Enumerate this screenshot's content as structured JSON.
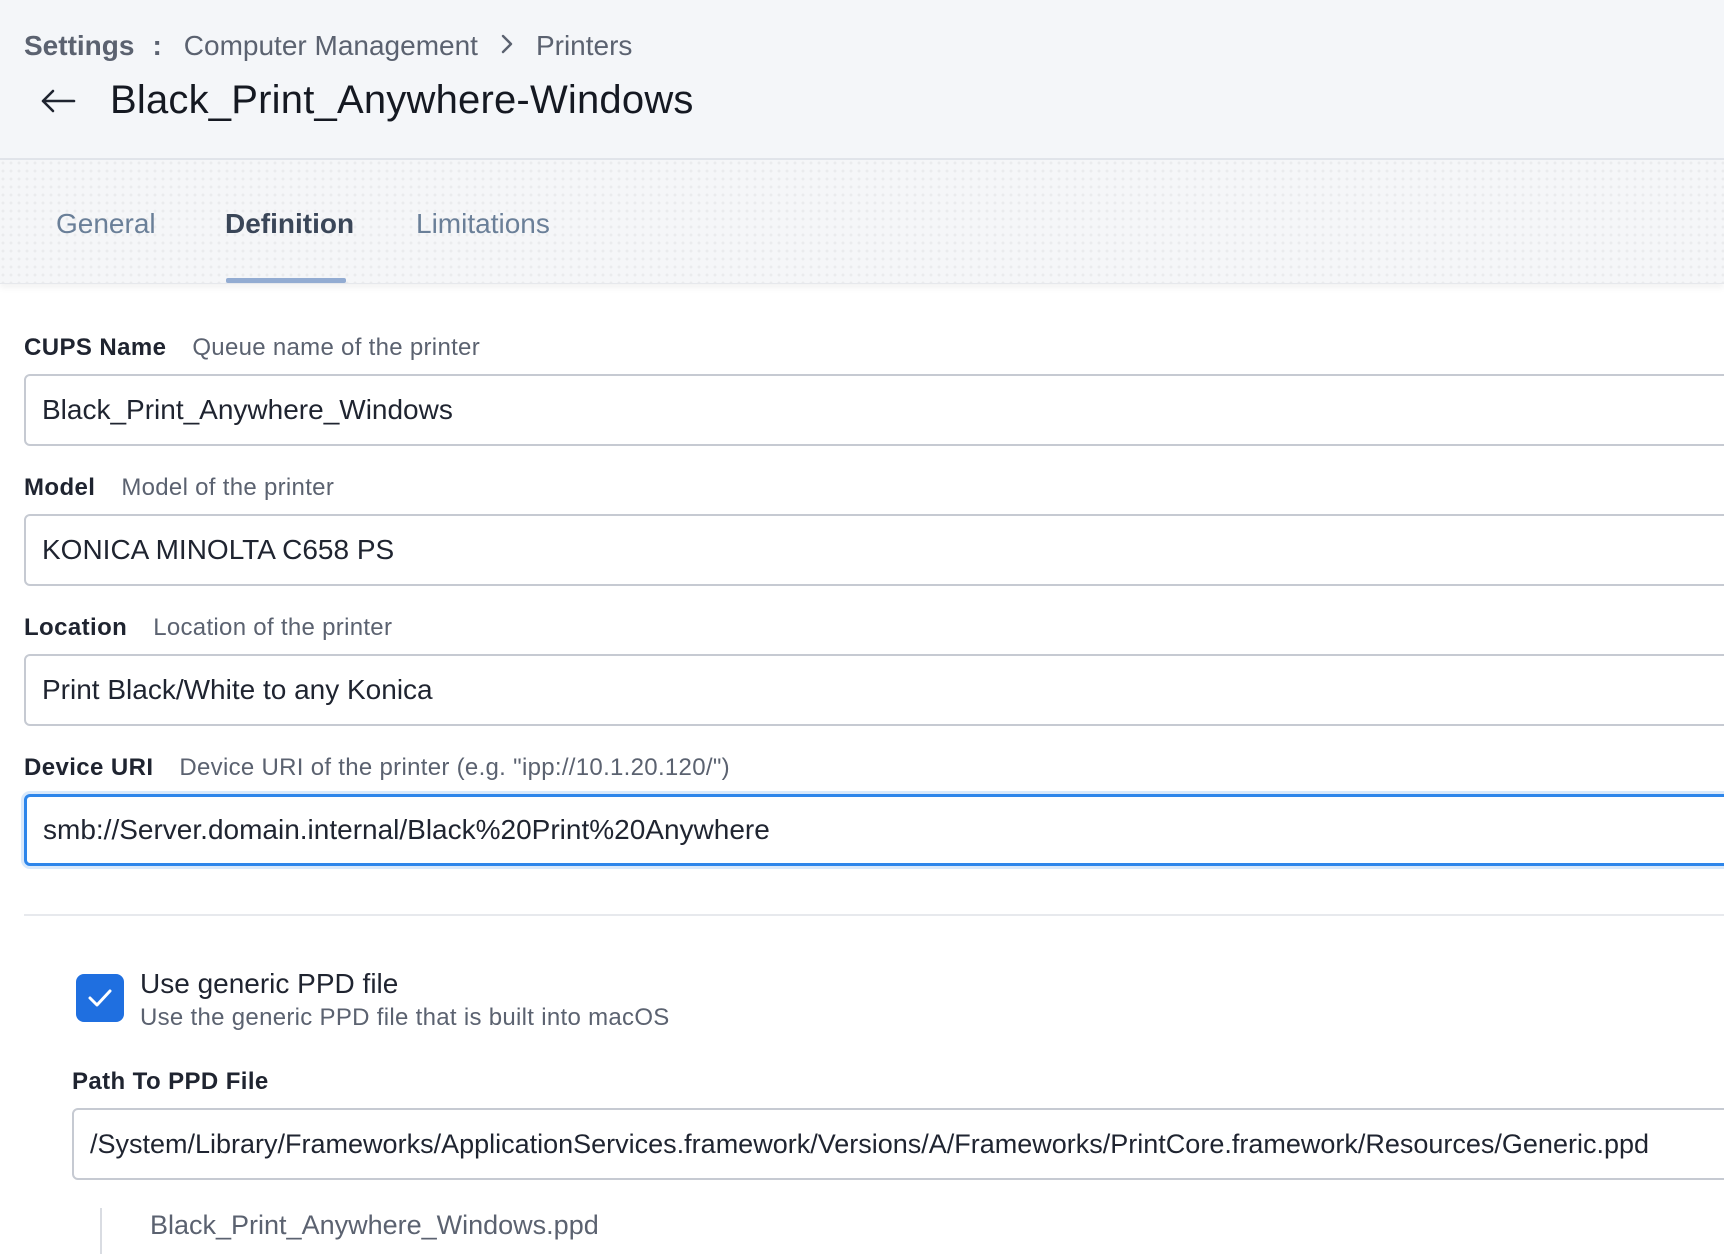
{
  "breadcrumb": {
    "root": "Settings",
    "separator": ":",
    "items": [
      "Computer Management",
      "Printers"
    ]
  },
  "page": {
    "title": "Black_Print_Anywhere-Windows"
  },
  "tabs": [
    {
      "label": "General",
      "active": false
    },
    {
      "label": "Definition",
      "active": true
    },
    {
      "label": "Limitations",
      "active": false
    }
  ],
  "fields": {
    "cups_name": {
      "label": "CUPS Name",
      "hint": "Queue name of the printer",
      "value": "Black_Print_Anywhere_Windows"
    },
    "model": {
      "label": "Model",
      "hint": "Model of the printer",
      "value": "KONICA MINOLTA C658 PS"
    },
    "location": {
      "label": "Location",
      "hint": "Location of the printer",
      "value": "Print Black/White to any Konica"
    },
    "device_uri": {
      "label": "Device URI",
      "hint": "Device URI of the printer (e.g. \"ipp://10.1.20.120/\")",
      "value": "smb://Server.domain.internal/Black%20Print%20Anywhere"
    }
  },
  "generic_ppd": {
    "checked": true,
    "title": "Use generic PPD file",
    "subtitle": "Use the generic PPD file that is built into macOS"
  },
  "ppd_path": {
    "label": "Path To PPD File",
    "value": "/System/Library/Frameworks/ApplicationServices.framework/Versions/A/Frameworks/PrintCore.framework/Resources/Generic.ppd",
    "file_name": "Black_Print_Anywhere_Windows.ppd"
  },
  "colors": {
    "accent": "#1f6fe0",
    "focus": "#2e86ea",
    "tab_underline": "#93acd2"
  }
}
